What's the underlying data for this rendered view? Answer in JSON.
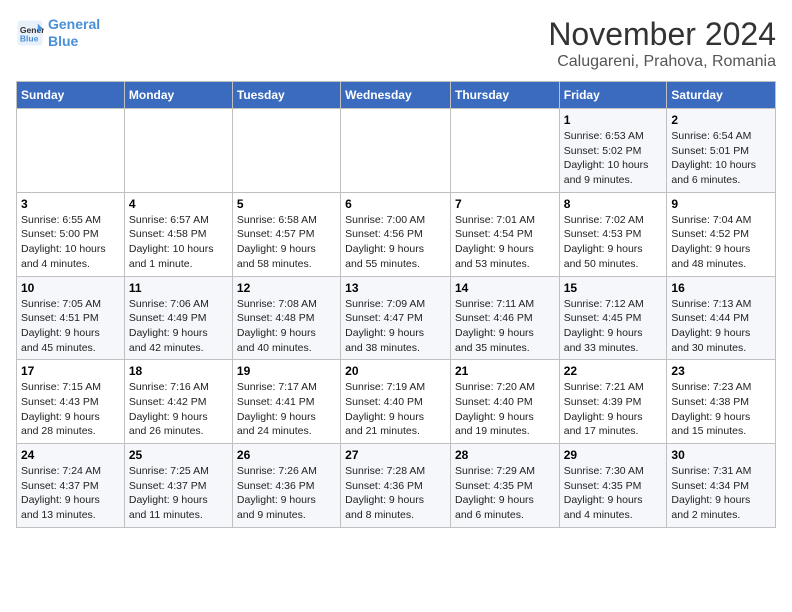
{
  "logo": {
    "line1": "General",
    "line2": "Blue"
  },
  "title": "November 2024",
  "subtitle": "Calugareni, Prahova, Romania",
  "weekdays": [
    "Sunday",
    "Monday",
    "Tuesday",
    "Wednesday",
    "Thursday",
    "Friday",
    "Saturday"
  ],
  "weeks": [
    [
      {
        "day": "",
        "info": ""
      },
      {
        "day": "",
        "info": ""
      },
      {
        "day": "",
        "info": ""
      },
      {
        "day": "",
        "info": ""
      },
      {
        "day": "",
        "info": ""
      },
      {
        "day": "1",
        "info": "Sunrise: 6:53 AM\nSunset: 5:02 PM\nDaylight: 10 hours\nand 9 minutes."
      },
      {
        "day": "2",
        "info": "Sunrise: 6:54 AM\nSunset: 5:01 PM\nDaylight: 10 hours\nand 6 minutes."
      }
    ],
    [
      {
        "day": "3",
        "info": "Sunrise: 6:55 AM\nSunset: 5:00 PM\nDaylight: 10 hours\nand 4 minutes."
      },
      {
        "day": "4",
        "info": "Sunrise: 6:57 AM\nSunset: 4:58 PM\nDaylight: 10 hours\nand 1 minute."
      },
      {
        "day": "5",
        "info": "Sunrise: 6:58 AM\nSunset: 4:57 PM\nDaylight: 9 hours\nand 58 minutes."
      },
      {
        "day": "6",
        "info": "Sunrise: 7:00 AM\nSunset: 4:56 PM\nDaylight: 9 hours\nand 55 minutes."
      },
      {
        "day": "7",
        "info": "Sunrise: 7:01 AM\nSunset: 4:54 PM\nDaylight: 9 hours\nand 53 minutes."
      },
      {
        "day": "8",
        "info": "Sunrise: 7:02 AM\nSunset: 4:53 PM\nDaylight: 9 hours\nand 50 minutes."
      },
      {
        "day": "9",
        "info": "Sunrise: 7:04 AM\nSunset: 4:52 PM\nDaylight: 9 hours\nand 48 minutes."
      }
    ],
    [
      {
        "day": "10",
        "info": "Sunrise: 7:05 AM\nSunset: 4:51 PM\nDaylight: 9 hours\nand 45 minutes."
      },
      {
        "day": "11",
        "info": "Sunrise: 7:06 AM\nSunset: 4:49 PM\nDaylight: 9 hours\nand 42 minutes."
      },
      {
        "day": "12",
        "info": "Sunrise: 7:08 AM\nSunset: 4:48 PM\nDaylight: 9 hours\nand 40 minutes."
      },
      {
        "day": "13",
        "info": "Sunrise: 7:09 AM\nSunset: 4:47 PM\nDaylight: 9 hours\nand 38 minutes."
      },
      {
        "day": "14",
        "info": "Sunrise: 7:11 AM\nSunset: 4:46 PM\nDaylight: 9 hours\nand 35 minutes."
      },
      {
        "day": "15",
        "info": "Sunrise: 7:12 AM\nSunset: 4:45 PM\nDaylight: 9 hours\nand 33 minutes."
      },
      {
        "day": "16",
        "info": "Sunrise: 7:13 AM\nSunset: 4:44 PM\nDaylight: 9 hours\nand 30 minutes."
      }
    ],
    [
      {
        "day": "17",
        "info": "Sunrise: 7:15 AM\nSunset: 4:43 PM\nDaylight: 9 hours\nand 28 minutes."
      },
      {
        "day": "18",
        "info": "Sunrise: 7:16 AM\nSunset: 4:42 PM\nDaylight: 9 hours\nand 26 minutes."
      },
      {
        "day": "19",
        "info": "Sunrise: 7:17 AM\nSunset: 4:41 PM\nDaylight: 9 hours\nand 24 minutes."
      },
      {
        "day": "20",
        "info": "Sunrise: 7:19 AM\nSunset: 4:40 PM\nDaylight: 9 hours\nand 21 minutes."
      },
      {
        "day": "21",
        "info": "Sunrise: 7:20 AM\nSunset: 4:40 PM\nDaylight: 9 hours\nand 19 minutes."
      },
      {
        "day": "22",
        "info": "Sunrise: 7:21 AM\nSunset: 4:39 PM\nDaylight: 9 hours\nand 17 minutes."
      },
      {
        "day": "23",
        "info": "Sunrise: 7:23 AM\nSunset: 4:38 PM\nDaylight: 9 hours\nand 15 minutes."
      }
    ],
    [
      {
        "day": "24",
        "info": "Sunrise: 7:24 AM\nSunset: 4:37 PM\nDaylight: 9 hours\nand 13 minutes."
      },
      {
        "day": "25",
        "info": "Sunrise: 7:25 AM\nSunset: 4:37 PM\nDaylight: 9 hours\nand 11 minutes."
      },
      {
        "day": "26",
        "info": "Sunrise: 7:26 AM\nSunset: 4:36 PM\nDaylight: 9 hours\nand 9 minutes."
      },
      {
        "day": "27",
        "info": "Sunrise: 7:28 AM\nSunset: 4:36 PM\nDaylight: 9 hours\nand 8 minutes."
      },
      {
        "day": "28",
        "info": "Sunrise: 7:29 AM\nSunset: 4:35 PM\nDaylight: 9 hours\nand 6 minutes."
      },
      {
        "day": "29",
        "info": "Sunrise: 7:30 AM\nSunset: 4:35 PM\nDaylight: 9 hours\nand 4 minutes."
      },
      {
        "day": "30",
        "info": "Sunrise: 7:31 AM\nSunset: 4:34 PM\nDaylight: 9 hours\nand 2 minutes."
      }
    ]
  ]
}
